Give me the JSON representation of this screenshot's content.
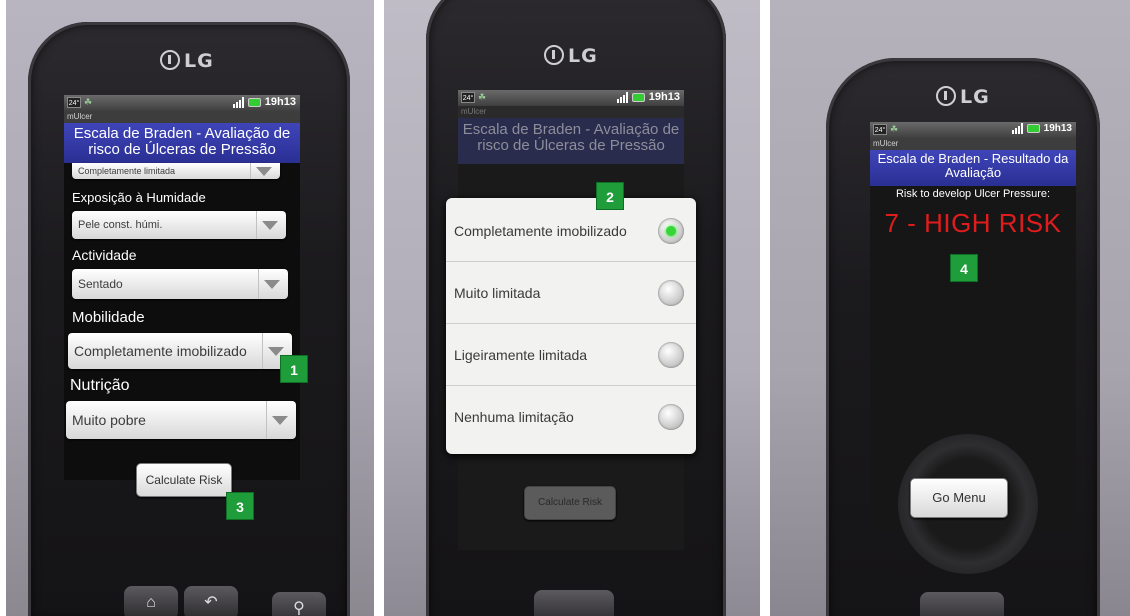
{
  "phone_brand": "LG",
  "status_bar": {
    "badge": "24°",
    "time": "19h13"
  },
  "app_name": "mUlcer",
  "screen1": {
    "title": "Escala de Braden - Avaliação de risco de Úlceras de Pressão",
    "partial_value": "Completamente limitada",
    "fields": [
      {
        "label": "Exposição à Humidade",
        "value": "Pele const. húmi."
      },
      {
        "label": "Actividade",
        "value": "Sentado"
      },
      {
        "label": "Mobilidade",
        "value": "Completamente imobilizado"
      },
      {
        "label": "Nutrição",
        "value": "Muito pobre"
      }
    ],
    "calculate_button": "Calculate Risk"
  },
  "screen2": {
    "title": "Escala de Braden - Avaliação de risco de Úlceras de Pressão",
    "options": [
      "Completamente imobilizado",
      "Muito limitada",
      "Ligeiramente limitada",
      "Nenhuma limitação"
    ],
    "selected_index": 0,
    "calculate_button": "Calculate Risk"
  },
  "screen3": {
    "title": "Escala de Braden - Resultado da Avaliação",
    "risk_label": "Risk to develop Ulcer Pressure:",
    "risk_result": "7 - HIGH RISK",
    "go_menu_button": "Go Menu"
  },
  "markers": [
    "1",
    "2",
    "3",
    "4"
  ],
  "colors": {
    "title_bar": "#3a40b0",
    "risk_text": "#e01c1c",
    "marker_green": "#1f9d3a"
  }
}
